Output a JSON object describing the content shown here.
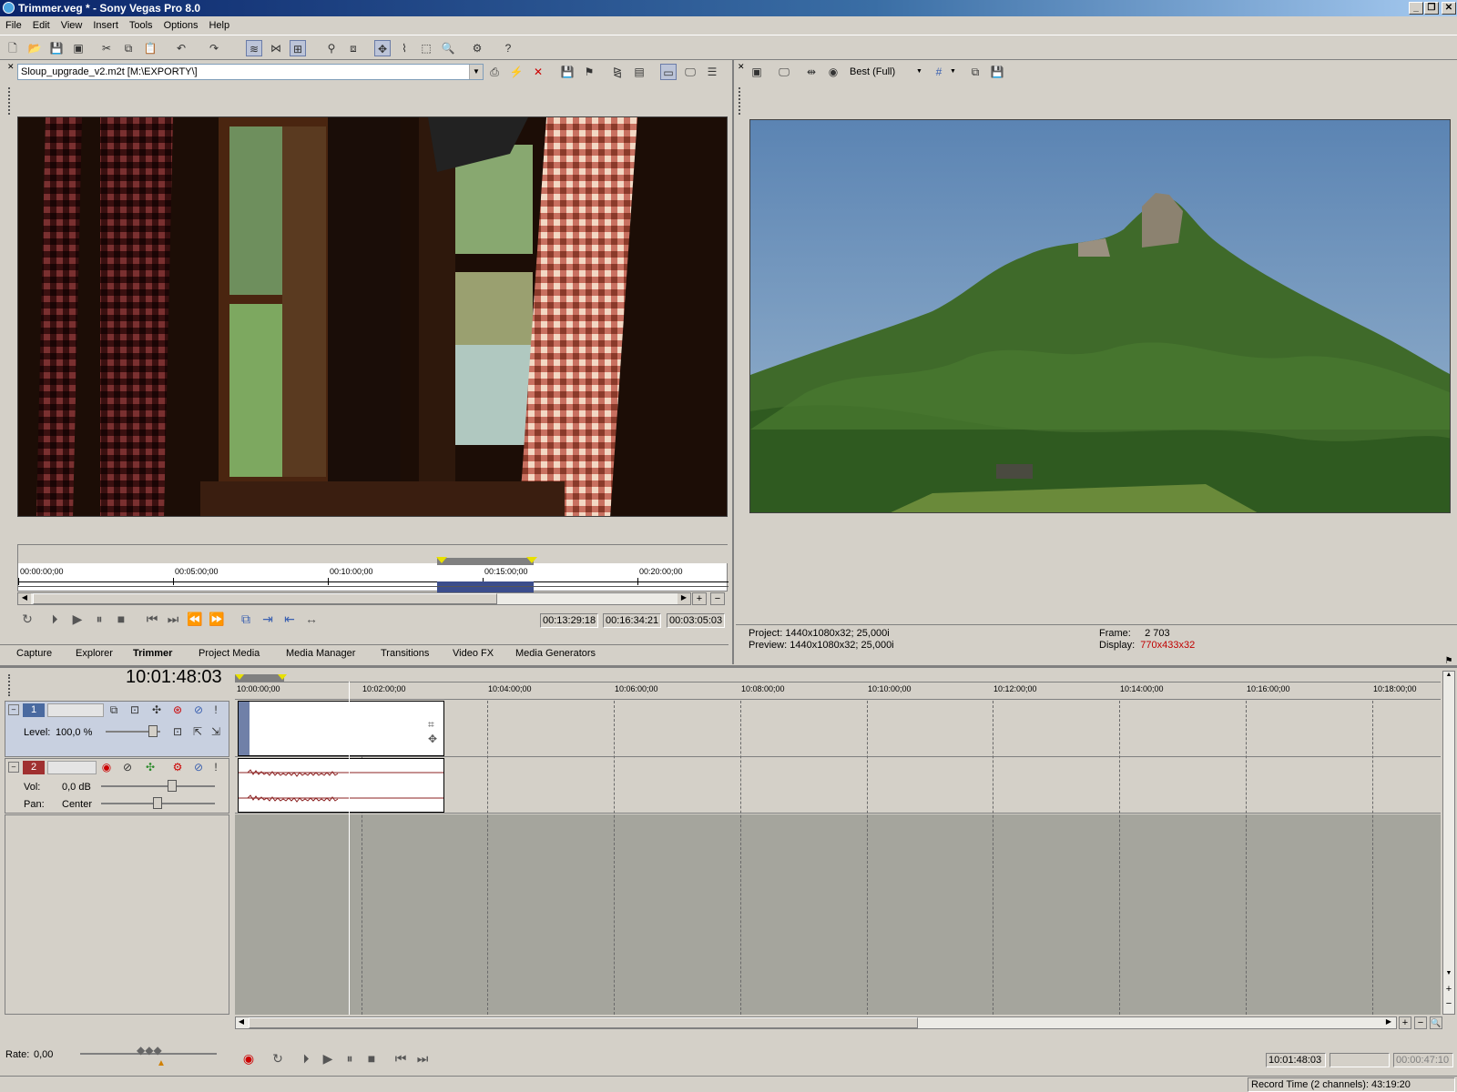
{
  "window": {
    "title": "Trimmer.veg * - Sony Vegas Pro 8.0",
    "buttons": [
      "_",
      "❐",
      "✕"
    ]
  },
  "menu": [
    "File",
    "Edit",
    "View",
    "Insert",
    "Tools",
    "Options",
    "Help"
  ],
  "trimmer": {
    "file": "Sloup_upgrade_v2.m2t    [M:\\EXPORTY\\]",
    "ruler": [
      "00:00:00;00",
      "00:05:00;00",
      "00:10:00;00",
      "00:15:00;00",
      "00:20:00;00"
    ],
    "timecodes": {
      "in": "00:13:29:18",
      "out": "00:16:34:21",
      "length": "00:03:05:03"
    }
  },
  "tabs": [
    "Capture",
    "Explorer",
    "Trimmer",
    "Project Media",
    "Media Manager",
    "Transitions",
    "Video FX",
    "Media Generators"
  ],
  "active_tab": "Trimmer",
  "preview": {
    "quality": "Best (Full)",
    "project_label": "Project:",
    "project": "1440x1080x32; 25,000i",
    "preview_label": "Preview:",
    "preview": "1440x1080x32; 25,000i",
    "frame_label": "Frame:",
    "frame": "2 703",
    "display_label": "Display:",
    "display": "770x433x32"
  },
  "timeline": {
    "cursor": "10:01:48:03",
    "ruler": [
      "10:00:00;00",
      "10:02:00;00",
      "10:04:00;00",
      "10:06:00;00",
      "10:08:00;00",
      "10:10:00;00",
      "10:12:00;00",
      "10:14:00;00",
      "10:16:00;00",
      "10:18:00;00"
    ],
    "video_track": {
      "number": "1",
      "level_label": "Level:",
      "level": "100,0 %"
    },
    "audio_track": {
      "number": "2",
      "vol_label": "Vol:",
      "vol": "0,0 dB",
      "pan_label": "Pan:",
      "pan": "Center"
    },
    "rate_label": "Rate:",
    "rate": "0,00",
    "bottom_tc": {
      "position": "10:01:48:03",
      "selection": "",
      "length": "00:00:47:10"
    }
  },
  "status": "Record Time (2 channels): 43:19:20",
  "colors": {
    "display_value": "#c00000",
    "audio_clip": "#8b2020",
    "video_track": "#4a6aa0",
    "audio_track": "#a03030"
  }
}
